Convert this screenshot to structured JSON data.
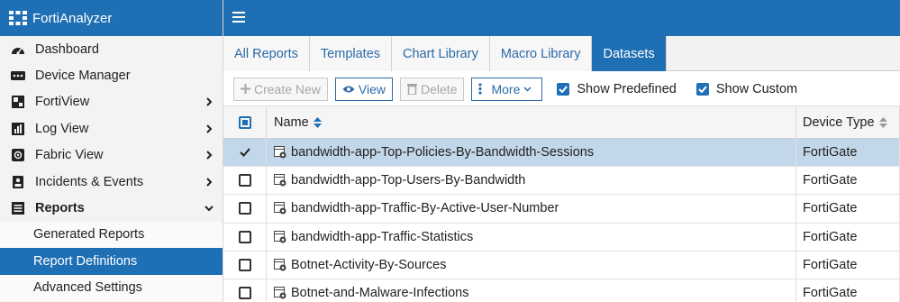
{
  "app": {
    "title": "FortiAnalyzer"
  },
  "sidebar": {
    "items": [
      {
        "label": "Dashboard",
        "icon": "dashboard-icon"
      },
      {
        "label": "Device Manager",
        "icon": "device-manager-icon"
      },
      {
        "label": "FortiView",
        "icon": "fortiview-icon"
      },
      {
        "label": "Log View",
        "icon": "log-view-icon"
      },
      {
        "label": "Fabric View",
        "icon": "fabric-view-icon"
      },
      {
        "label": "Incidents & Events",
        "icon": "incidents-icon"
      },
      {
        "label": "Reports",
        "icon": "reports-icon"
      }
    ],
    "subitems": [
      {
        "label": "Generated Reports"
      },
      {
        "label": "Report Definitions"
      },
      {
        "label": "Advanced Settings"
      }
    ]
  },
  "tabs": [
    {
      "label": "All Reports"
    },
    {
      "label": "Templates"
    },
    {
      "label": "Chart Library"
    },
    {
      "label": "Macro Library"
    },
    {
      "label": "Datasets"
    }
  ],
  "toolbar": {
    "create_new": "Create New",
    "view": "View",
    "delete": "Delete",
    "more": "More",
    "show_predefined": "Show Predefined",
    "show_custom": "Show Custom"
  },
  "table": {
    "columns": {
      "name": "Name",
      "device_type": "Device Type"
    },
    "rows": [
      {
        "name": "bandwidth-app-Top-Policies-By-Bandwidth-Sessions",
        "device_type": "FortiGate",
        "checked": true
      },
      {
        "name": "bandwidth-app-Top-Users-By-Bandwidth",
        "device_type": "FortiGate",
        "checked": false
      },
      {
        "name": "bandwidth-app-Traffic-By-Active-User-Number",
        "device_type": "FortiGate",
        "checked": false
      },
      {
        "name": "bandwidth-app-Traffic-Statistics",
        "device_type": "FortiGate",
        "checked": false
      },
      {
        "name": "Botnet-Activity-By-Sources",
        "device_type": "FortiGate",
        "checked": false
      },
      {
        "name": "Botnet-and-Malware-Infections",
        "device_type": "FortiGate",
        "checked": false
      }
    ]
  },
  "colors": {
    "brand": "#1f6fb5",
    "selected_row": "#c3d7ea",
    "link": "#2c6aa8"
  }
}
